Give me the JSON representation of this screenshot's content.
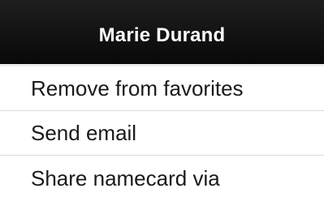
{
  "dialog": {
    "title": "Marie Durand",
    "items": [
      {
        "label": "Remove from favorites"
      },
      {
        "label": "Send email"
      },
      {
        "label": "Share namecard via"
      }
    ]
  },
  "colors": {
    "header_bg": "#121212",
    "header_text": "#ffffff",
    "item_text": "#1a1a1a",
    "divider": "#d9d9d9",
    "background": "#ffffff"
  }
}
